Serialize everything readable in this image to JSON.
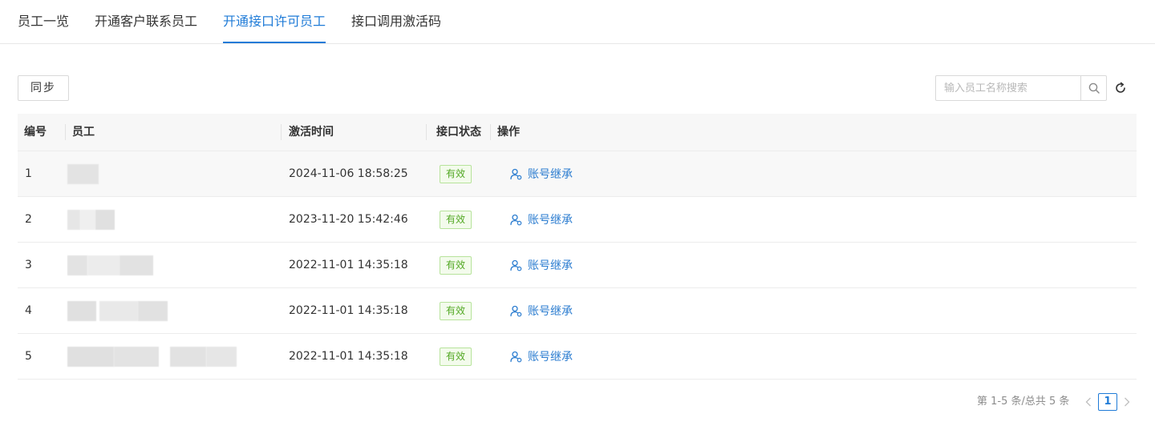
{
  "tabs": [
    {
      "label": "员工一览"
    },
    {
      "label": "开通客户联系员工"
    },
    {
      "label": "开通接口许可员工",
      "active": true
    },
    {
      "label": "接口调用激活码"
    }
  ],
  "toolbar": {
    "sync_label": "同步",
    "search_placeholder": "输入员工名称搜索",
    "search_icon": "search-icon",
    "refresh_icon": "refresh-icon"
  },
  "table": {
    "headers": [
      "编号",
      "员工",
      "激活时间",
      "接口状态",
      "操作"
    ],
    "rows": [
      {
        "id": "1",
        "employee": "",
        "activated_at": "2024-11-06 18:58:25",
        "status": "有效",
        "action": "账号继承"
      },
      {
        "id": "2",
        "employee": "",
        "activated_at": "2023-11-20 15:42:46",
        "status": "有效",
        "action": "账号继承"
      },
      {
        "id": "3",
        "employee": "",
        "activated_at": "2022-11-01 14:35:18",
        "status": "有效",
        "action": "账号继承"
      },
      {
        "id": "4",
        "employee": "",
        "activated_at": "2022-11-01 14:35:18",
        "status": "有效",
        "action": "账号继承"
      },
      {
        "id": "5",
        "employee": "",
        "activated_at": "2022-11-01 14:35:18",
        "status": "有效",
        "action": "账号继承"
      }
    ]
  },
  "pagination": {
    "summary": "第 1-5 条/总共 5 条",
    "current_page": "1"
  },
  "colors": {
    "accent": "#1f7bd7",
    "link": "#2c7dd0",
    "status_valid_text": "#52a823",
    "status_valid_bg": "#f3fbec",
    "status_valid_border": "#b7e39b"
  }
}
